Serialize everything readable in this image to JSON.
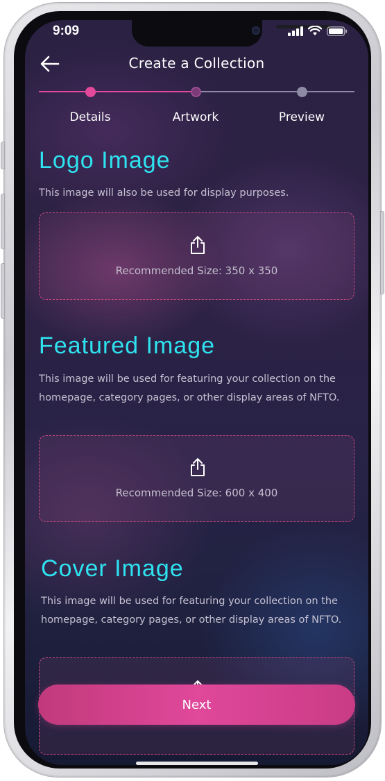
{
  "status_bar": {
    "time": "9:09"
  },
  "header": {
    "title": "Create a Collection"
  },
  "stepper": {
    "steps": [
      "Details",
      "Artwork",
      "Preview"
    ],
    "active_index": 1,
    "colors": {
      "active": "#e2499a",
      "inactive": "#8e8aa5",
      "current": "#7b3a78"
    }
  },
  "sections": [
    {
      "title": "Logo Image",
      "description": "This image will also be used for display purposes.",
      "dropzone_text": "Recommended Size: 350 x 350"
    },
    {
      "title": "Featured Image",
      "description": "This image will be used for featuring your collection on the homepage, category pages, or other display areas of NFTO.",
      "dropzone_text": "Recommended Size: 600 x 400"
    },
    {
      "title": "Cover Image",
      "description": "This image will be used for featuring your collection on the homepage, category pages, or other display areas of NFTO.",
      "dropzone_text": ""
    }
  ],
  "actions": {
    "next_label": "Next"
  },
  "icons": {
    "back": "arrow-left-icon",
    "upload": "share-upload-icon",
    "signal": "cellular-signal-icon",
    "wifi": "wifi-icon",
    "battery": "battery-icon"
  },
  "colors": {
    "accent": "#2fe2ef",
    "button": "#e0489a",
    "dashed_border": "#c8487f"
  }
}
